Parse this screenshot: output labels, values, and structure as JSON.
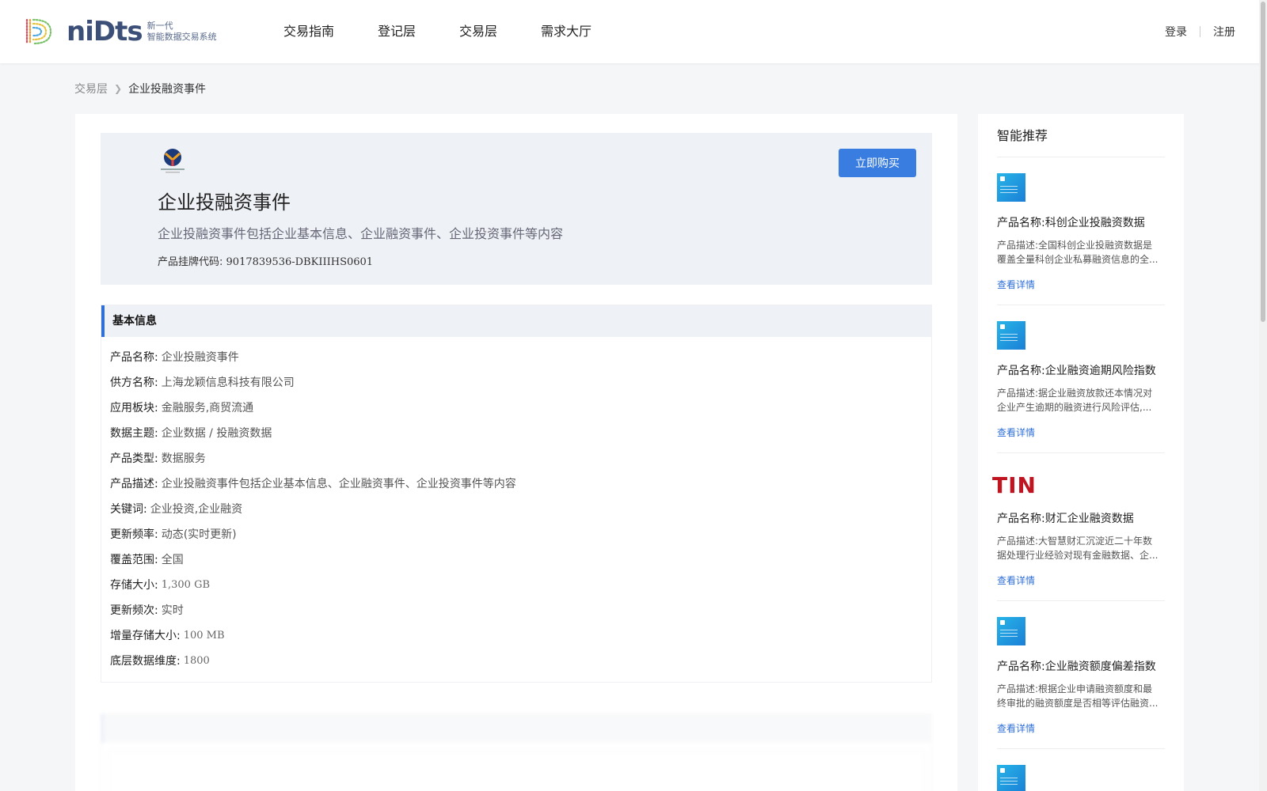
{
  "header": {
    "logo_word": "niDts",
    "logo_sub_line1": "新一代",
    "logo_sub_line2": "智能数据交易系统",
    "nav": [
      "交易指南",
      "登记层",
      "交易层",
      "需求大厅"
    ],
    "login": "登录",
    "register": "注册"
  },
  "breadcrumb": {
    "parent": "交易层",
    "current": "企业投融资事件"
  },
  "hero": {
    "title": "企业投融资事件",
    "description": "企业投融资事件包括企业基本信息、企业融资事件、企业投资事件等内容",
    "code_label": "产品挂牌代码:",
    "code_value": "9017839536-DBKIIIHS0601",
    "buy_label": "立即购买"
  },
  "info": {
    "heading": "基本信息",
    "rows": [
      {
        "k": "产品名称:",
        "v": "企业投融资事件"
      },
      {
        "k": "供方名称:",
        "v": "上海龙颖信息科技有限公司"
      },
      {
        "k": "应用板块:",
        "v": "金融服务,商贸流通"
      },
      {
        "k": "数据主题:",
        "v": "企业数据 / 投融资数据"
      },
      {
        "k": "产品类型:",
        "v": "数据服务"
      },
      {
        "k": "产品描述:",
        "v": "企业投融资事件包括企业基本信息、企业融资事件、企业投资事件等内容"
      },
      {
        "k": "关键词:",
        "v": "企业投资,企业融资"
      },
      {
        "k": "更新频率:",
        "v": "动态(实时更新)"
      },
      {
        "k": "覆盖范围:",
        "v": "全国"
      },
      {
        "k": "存储大小:",
        "v": "1,300 GB"
      },
      {
        "k": "更新频次:",
        "v": "实时"
      },
      {
        "k": "增量存储大小:",
        "v": "100 MB"
      },
      {
        "k": "底层数据维度:",
        "v": "1800"
      }
    ]
  },
  "sidebar": {
    "title": "智能推荐",
    "items": [
      {
        "name": "产品名称:科创企业投融资数据",
        "desc": "产品描述:全国科创企业投融资数据是覆盖全量科创企业私募融资信息的全...",
        "link": "查看详情"
      },
      {
        "name": "产品名称:企业融资逾期风险指数",
        "desc": "产品描述:据企业融资放款还本情况对企业产生逾期的融资进行风险评估,...",
        "link": "查看详情"
      },
      {
        "name": "产品名称:财汇企业融资数据",
        "desc": "产品描述:大智慧财汇沉淀近二十年数据处理行业经验对现有金融数据、企...",
        "link": "查看详情",
        "thumb_text": "TIN"
      },
      {
        "name": "产品名称:企业融资额度偏差指数",
        "desc": "产品描述:根据企业申请融资额度和最终审批的融资额度是否相等评估融资...",
        "link": "查看详情"
      }
    ]
  },
  "colors": {
    "accent": "#3a7de0",
    "brand_nav": "#3c4f78",
    "link": "#2f6fd6"
  }
}
